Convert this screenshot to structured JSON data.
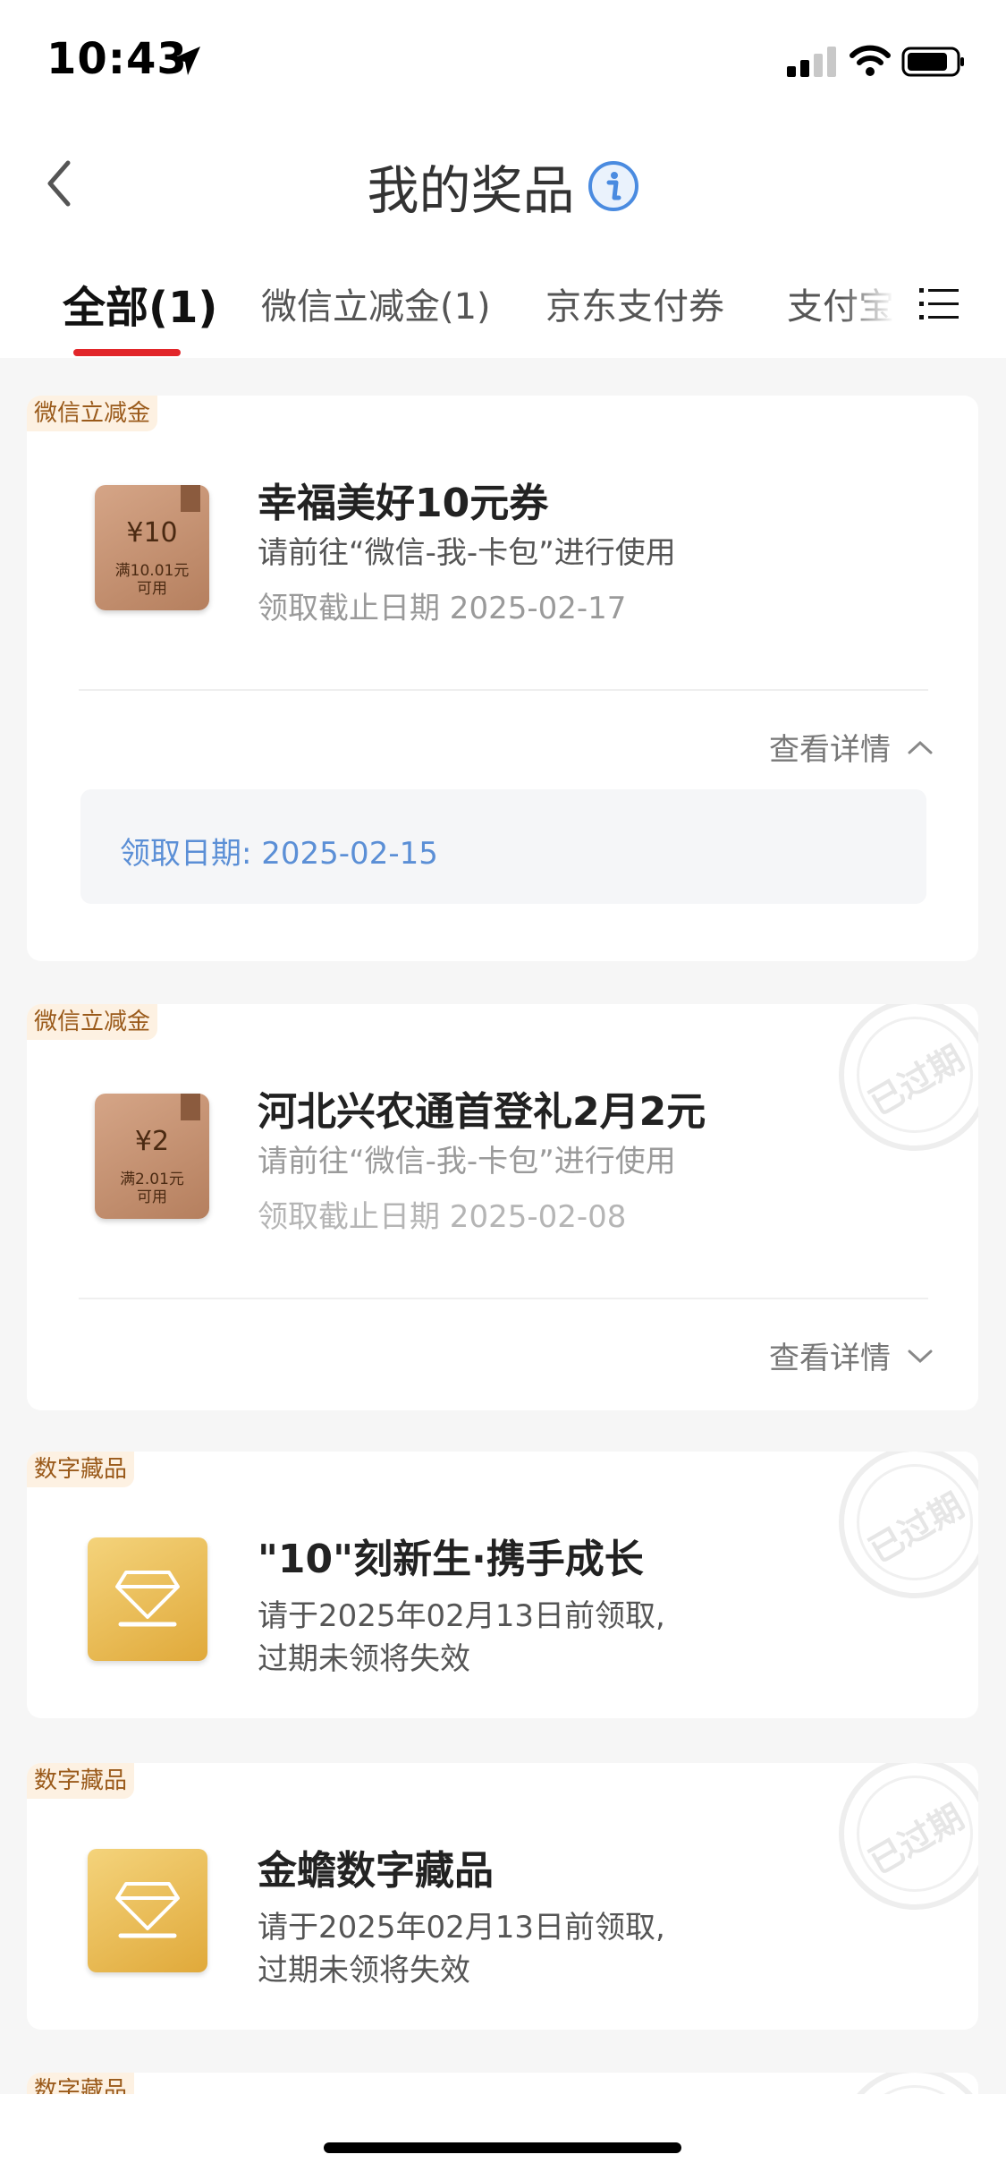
{
  "status_bar": {
    "time": "10:43"
  },
  "header": {
    "title": "我的奖品"
  },
  "tabs": [
    {
      "label": "全部(1)"
    },
    {
      "label": "微信立减金(1)"
    },
    {
      "label": "京东支付券"
    },
    {
      "label": "支付宝"
    }
  ],
  "colors": {
    "accent": "#e2262a",
    "link": "#5b8fd6",
    "tag_bg": "#fdf1e2",
    "tag_text": "#9a5a1a"
  },
  "prizes": [
    {
      "tag": "微信立减金",
      "coupon_amount": "¥10",
      "coupon_condition": "满10.01元",
      "coupon_usable": "可用",
      "title": "幸福美好10元券",
      "line1": "请前往“微信-我-卡包”进行使用",
      "line2": "领取截止日期 2025-02-17",
      "detail_label": "查看详情",
      "receive_date": "领取日期: 2025-02-15",
      "expanded": true,
      "expired": false
    },
    {
      "tag": "微信立减金",
      "coupon_amount": "¥2",
      "coupon_condition": "满2.01元",
      "coupon_usable": "可用",
      "title": "河北兴农通首登礼2月2元",
      "line1": "请前往“微信-我-卡包”进行使用",
      "line2": "领取截止日期 2025-02-08",
      "detail_label": "查看详情",
      "expanded": false,
      "expired": true,
      "stamp": "已过期"
    },
    {
      "tag": "数字藏品",
      "title": "\"10\"刻新生·携手成长",
      "line1": "请于2025年02月13日前领取,",
      "line2": "过期未领将失效",
      "expired": true,
      "stamp": "已过期"
    },
    {
      "tag": "数字藏品",
      "title": "金蟾数字藏品",
      "line1": "请于2025年02月13日前领取,",
      "line2": "过期未领将失效",
      "expired": true,
      "stamp": "已过期"
    },
    {
      "tag": "数字藏品"
    }
  ]
}
